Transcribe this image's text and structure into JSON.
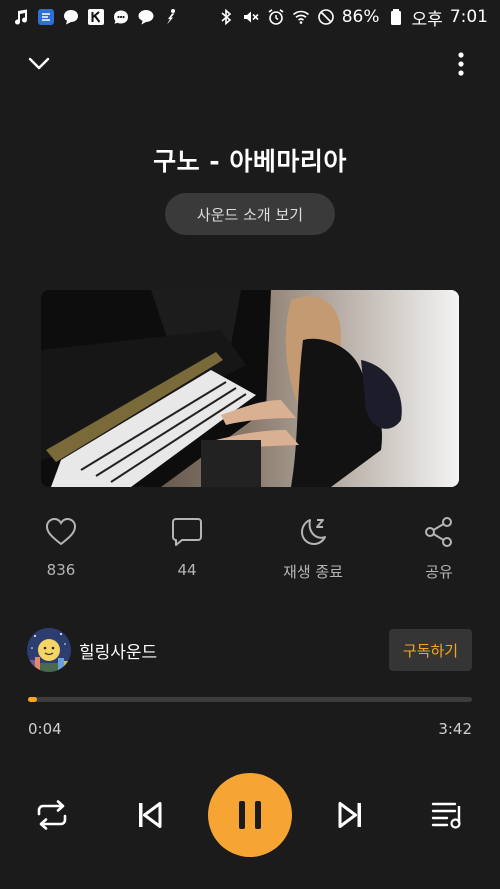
{
  "status_bar": {
    "battery_percent": "86%",
    "ampm": "오후",
    "time": "7:01",
    "left_icons": [
      "music-note-icon",
      "app-icon",
      "chat-bubble-icon",
      "k-app-icon",
      "message-icon",
      "talk-icon",
      "figure-icon"
    ],
    "right_icons": [
      "bluetooth-icon",
      "mute-icon",
      "alarm-icon",
      "wifi-icon",
      "do-not-disturb-icon",
      "battery-icon"
    ]
  },
  "player": {
    "title": "구노 - 아베마리아",
    "intro_button": "사운드 소개 보기"
  },
  "actions": [
    {
      "name": "like",
      "icon": "heart-icon",
      "label": "836"
    },
    {
      "name": "comment",
      "icon": "comment-icon",
      "label": "44"
    },
    {
      "name": "sleep-timer",
      "icon": "moon-sleep-icon",
      "label": "재생 종료"
    },
    {
      "name": "share",
      "icon": "share-icon",
      "label": "공유"
    }
  ],
  "channel": {
    "name": "힐링사운드",
    "subscribe_label": "구독하기"
  },
  "progress": {
    "current": "0:04",
    "total": "3:42",
    "fraction": 0.018
  },
  "colors": {
    "accent": "#f6a535",
    "background": "#1b1b1b"
  }
}
